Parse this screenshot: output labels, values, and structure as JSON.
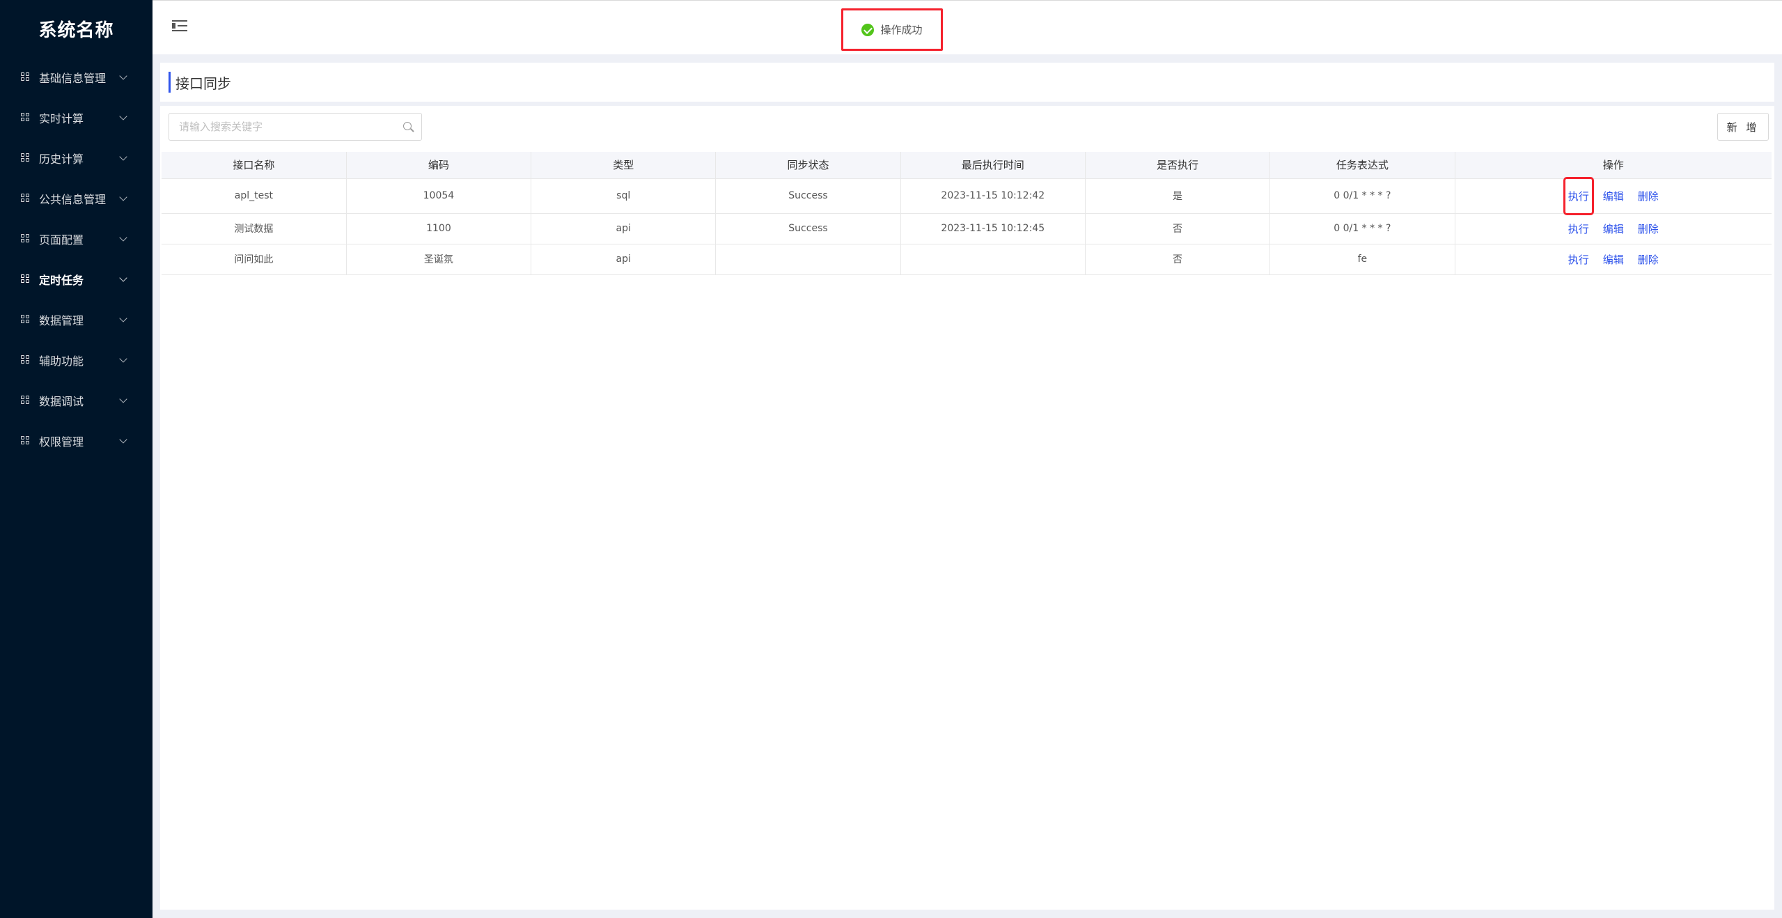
{
  "brand": "系统名称",
  "sidebar": {
    "items": [
      {
        "label": "基础信息管理"
      },
      {
        "label": "实时计算"
      },
      {
        "label": "历史计算"
      },
      {
        "label": "公共信息管理"
      },
      {
        "label": "页面配置"
      },
      {
        "label": "定时任务",
        "active": true
      },
      {
        "label": "数据管理"
      },
      {
        "label": "辅助功能"
      },
      {
        "label": "数据调试"
      },
      {
        "label": "权限管理"
      }
    ]
  },
  "toast": {
    "message": "操作成功",
    "color": "#52c41a"
  },
  "page": {
    "title": "接口同步"
  },
  "search": {
    "placeholder": "请输入搜索关键字"
  },
  "toolbar": {
    "add_label": "新 增"
  },
  "table": {
    "columns": [
      "接口名称",
      "编码",
      "类型",
      "同步状态",
      "最后执行时间",
      "是否执行",
      "任务表达式",
      "操作"
    ],
    "rows": [
      {
        "name": "apl_test",
        "code": "10054",
        "type": "sql",
        "status": "Success",
        "last_time": "2023-11-15 10:12:42",
        "enabled": "是",
        "cron": "0 0/1 * * * ?"
      },
      {
        "name": "测试数据",
        "code": "1100",
        "type": "api",
        "status": "Success",
        "last_time": "2023-11-15 10:12:45",
        "enabled": "否",
        "cron": "0 0/1 * * * ?"
      },
      {
        "name": "问问如此",
        "code": "圣诞氛",
        "type": "api",
        "status": "",
        "last_time": "",
        "enabled": "否",
        "cron": "fe"
      }
    ],
    "actions": {
      "execute": "执行",
      "edit": "编辑",
      "delete": "删除"
    }
  },
  "colors": {
    "sidebar_bg": "#001529",
    "accent": "#2f54eb",
    "highlight": "#f5222d"
  }
}
